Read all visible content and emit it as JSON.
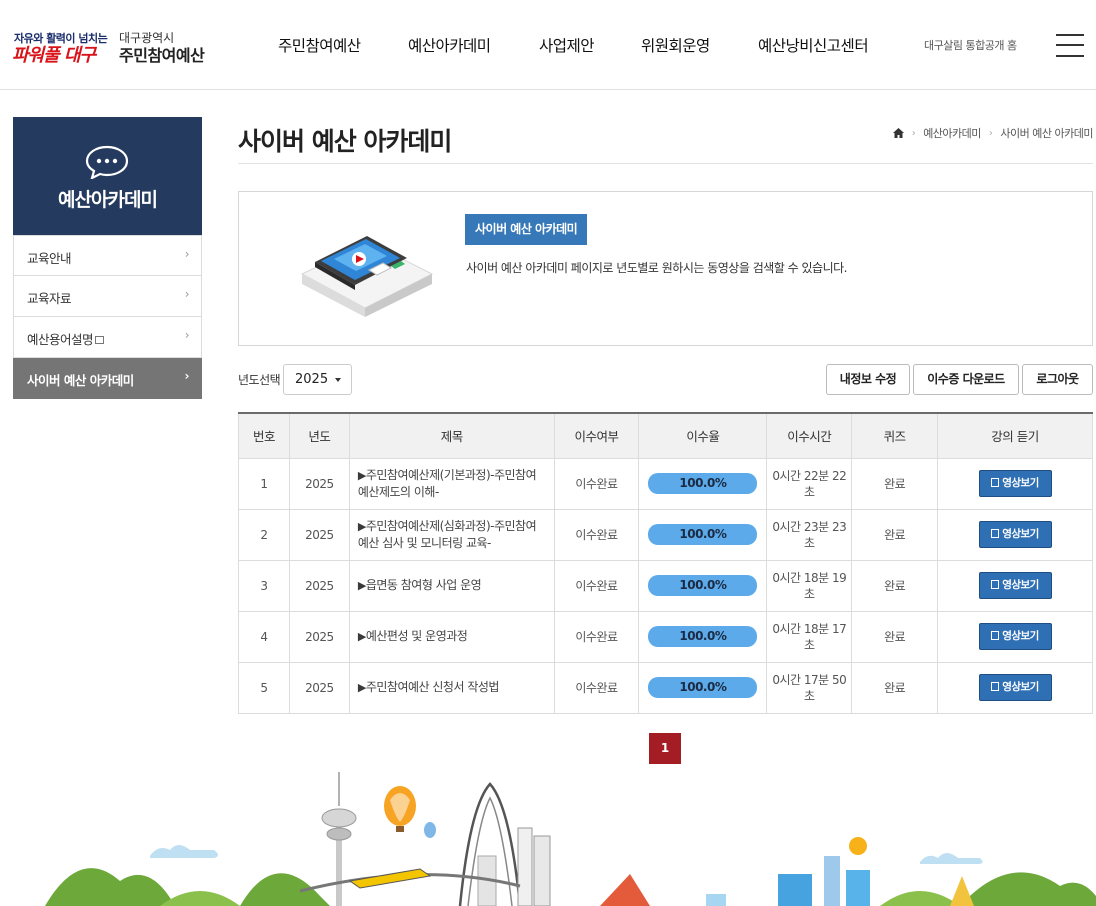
{
  "header": {
    "slogan_top": "자유와 활력이 넘치는",
    "slogan_big": "파워풀 대구",
    "city": "대구광역시",
    "org": "주민참여예산",
    "gnb": [
      "주민참여예산",
      "예산아카데미",
      "사업제안",
      "위원회운영",
      "예산낭비신고센터"
    ],
    "util_link": "대구살림 통합공개 홈",
    "menu_icon": "hamburger-icon"
  },
  "sidebar": {
    "title": "예산아카데미",
    "icon": "chat-bubble-icon",
    "items": [
      {
        "label": "교육안내",
        "active": false
      },
      {
        "label": "교육자료",
        "active": false
      },
      {
        "label": "예산용어설명",
        "active": false
      },
      {
        "label": "사이버 예산 아카데미",
        "active": true
      }
    ]
  },
  "content": {
    "page_title": "사이버 예산 아카데미",
    "breadcrumb": [
      "예산아카데미",
      "사이버 예산 아카데미"
    ],
    "intro": {
      "badge": "사이버 예산 아카데미",
      "description": "사이버 예산 아카데미 페이지로 년도별로 원하시는 동영상을 검색할 수 있습니다."
    },
    "filter": {
      "year_label": "년도선택",
      "year_value": "2025"
    },
    "buttons": {
      "edit_profile": "내정보 수정",
      "certificate": "이수증 다운로드",
      "logout": "로그아웃"
    },
    "table": {
      "headers": [
        "번호",
        "년도",
        "제목",
        "이수여부",
        "이수율",
        "이수시간",
        "퀴즈",
        "강의 듣기"
      ],
      "rows": [
        {
          "no": "1",
          "year": "2025",
          "title": "주민참여예산제(기본과정)-주민참여예산제도의 이해-",
          "status": "이수완료",
          "rate": "100.0%",
          "rate_value": 100,
          "time": "0시간 22분 22초",
          "quiz": "완료",
          "watch": "영상보기"
        },
        {
          "no": "2",
          "year": "2025",
          "title": "주민참여예산제(심화과정)-주민참여예산 심사 및 모니터링 교육-",
          "status": "이수완료",
          "rate": "100.0%",
          "rate_value": 100,
          "time": "0시간 23분 23초",
          "quiz": "완료",
          "watch": "영상보기"
        },
        {
          "no": "3",
          "year": "2025",
          "title": "읍면동 참여형 사업 운영",
          "status": "이수완료",
          "rate": "100.0%",
          "rate_value": 100,
          "time": "0시간 18분 19초",
          "quiz": "완료",
          "watch": "영상보기"
        },
        {
          "no": "4",
          "year": "2025",
          "title": "예산편성 및 운영과정",
          "status": "이수완료",
          "rate": "100.0%",
          "rate_value": 100,
          "time": "0시간 18분 17초",
          "quiz": "완료",
          "watch": "영상보기"
        },
        {
          "no": "5",
          "year": "2025",
          "title": "주민참여예산 신청서 작성법",
          "status": "이수완료",
          "rate": "100.0%",
          "rate_value": 100,
          "time": "0시간 17분 50초",
          "quiz": "완료",
          "watch": "영상보기"
        }
      ]
    },
    "pagination": {
      "current": "1"
    }
  },
  "colors": {
    "sidebar_head": "#243a5e",
    "sidebar_active": "#757575",
    "badge_blue": "#3779b8",
    "rate_bar": "#5caae9",
    "watch_btn": "#2f6fb3",
    "pager_active": "#a51d24",
    "brand_red": "#d8131a"
  }
}
